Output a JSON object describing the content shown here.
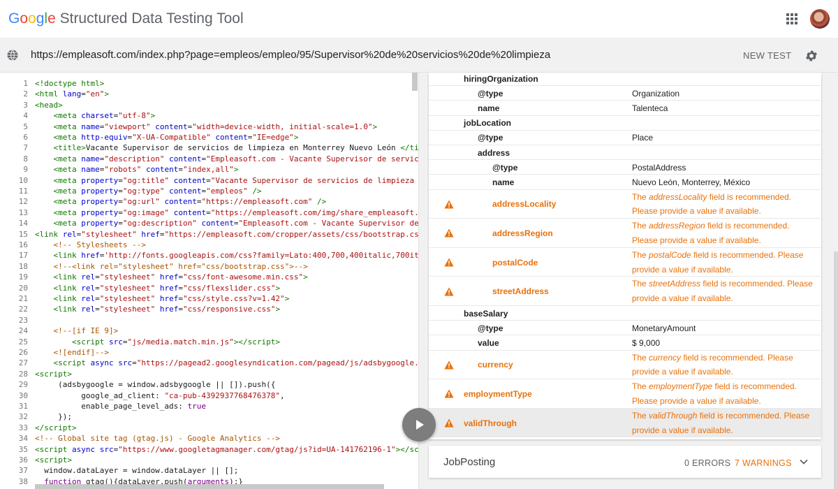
{
  "app": {
    "title_parts": [
      "G",
      "o",
      "o",
      "g",
      "l",
      "e"
    ],
    "title_rest": " Structured Data Testing Tool"
  },
  "toolbar": {
    "url": "https://empleasoft.com/index.php?page=empleos/empleo/95/Supervisor%20de%20servicios%20de%20limpieza",
    "new_test_label": "NEW TEST"
  },
  "colors": {
    "warning": "#e8710a",
    "accent_blue": "#4285f4"
  },
  "code": {
    "lines": [
      {
        "n": "1",
        "html": "<span class='tag'>&lt;!doctype html&gt;</span>"
      },
      {
        "n": "2",
        "html": "<span class='tag'>&lt;html</span> <span class='attr'>lang</span>=<span class='str'>\"en\"</span><span class='tag'>&gt;</span>"
      },
      {
        "n": "3",
        "html": "<span class='tag'>&lt;head&gt;</span>"
      },
      {
        "n": "4",
        "html": "    <span class='tag'>&lt;meta</span> <span class='attr'>charset</span>=<span class='str'>\"utf-8\"</span><span class='tag'>&gt;</span>"
      },
      {
        "n": "5",
        "html": "    <span class='tag'>&lt;meta</span> <span class='attr'>name</span>=<span class='str'>\"viewport\"</span> <span class='attr'>content</span>=<span class='str'>\"width=device-width, initial-scale=1.0\"</span><span class='tag'>&gt;</span>"
      },
      {
        "n": "6",
        "html": "    <span class='tag'>&lt;meta</span> <span class='attr'>http-equiv</span>=<span class='str'>\"X-UA-Compatible\"</span> <span class='attr'>content</span>=<span class='str'>\"IE=edge\"</span><span class='tag'>&gt;</span>"
      },
      {
        "n": "7",
        "html": "    <span class='tag'>&lt;title&gt;</span>Vacante Supervisor de servicios de limpieza en Monterrey Nuevo León <span class='tag'>&lt;/ti</span>"
      },
      {
        "n": "8",
        "html": "    <span class='tag'>&lt;meta</span> <span class='attr'>name</span>=<span class='str'>\"description\"</span> <span class='attr'>content</span>=<span class='str'>\"Empleasoft.com - Vacante Supervisor de servic</span>"
      },
      {
        "n": "9",
        "html": "    <span class='tag'>&lt;meta</span> <span class='attr'>name</span>=<span class='str'>\"robots\"</span> <span class='attr'>content</span>=<span class='str'>\"index,all\"</span><span class='tag'>&gt;</span>"
      },
      {
        "n": "10",
        "html": "    <span class='tag'>&lt;meta</span> <span class='attr'>property</span>=<span class='str'>\"og:title\"</span> <span class='attr'>content</span>=<span class='str'>\"Vacante Supervisor de servicios de limpieza</span>"
      },
      {
        "n": "11",
        "html": "    <span class='tag'>&lt;meta</span> <span class='attr'>property</span>=<span class='str'>\"og:type\"</span> <span class='attr'>content</span>=<span class='str'>\"empleos\"</span> <span class='tag'>/&gt;</span>"
      },
      {
        "n": "12",
        "html": "    <span class='tag'>&lt;meta</span> <span class='attr'>property</span>=<span class='str'>\"og:url\"</span> <span class='attr'>content</span>=<span class='str'>\"https://empleasoft.com\"</span> <span class='tag'>/&gt;</span>"
      },
      {
        "n": "13",
        "html": "    <span class='tag'>&lt;meta</span> <span class='attr'>property</span>=<span class='str'>\"og:image\"</span> <span class='attr'>content</span>=<span class='str'>\"https://empleasoft.com/img/share_empleasoft.</span>"
      },
      {
        "n": "14",
        "html": "    <span class='tag'>&lt;meta</span> <span class='attr'>property</span>=<span class='str'>\"og:description\"</span> <span class='attr'>content</span>=<span class='str'>\"Empleasoft.com - Vacante Supervisor de</span>"
      },
      {
        "n": "15",
        "html": "<span class='tag'>&lt;link</span> <span class='attr'>rel</span>=<span class='str'>\"stylesheet\"</span> <span class='attr'>href</span>=<span class='str'>\"https://empleasoft.com/cropper/assets/css/bootstrap.cs</span>"
      },
      {
        "n": "16",
        "html": "    <span class='cmt'>&lt;!-- Stylesheets --&gt;</span>"
      },
      {
        "n": "17",
        "html": "    <span class='tag'>&lt;link</span> <span class='attr'>href</span>=<span class='str'>'http://fonts.googleapis.com/css?family=Lato:400,700,400italic,700it</span>"
      },
      {
        "n": "18",
        "html": "    <span class='cmt'>&lt;!--&lt;link rel=\"stylesheet\" href=\"css/bootstrap.css\"&gt;--&gt;</span>"
      },
      {
        "n": "19",
        "html": "    <span class='tag'>&lt;link</span> <span class='attr'>rel</span>=<span class='str'>\"stylesheet\"</span> <span class='attr'>href</span>=<span class='str'>\"css/font-awesome.min.css\"</span><span class='tag'>&gt;</span>"
      },
      {
        "n": "20",
        "html": "    <span class='tag'>&lt;link</span> <span class='attr'>rel</span>=<span class='str'>\"stylesheet\"</span> <span class='attr'>href</span>=<span class='str'>\"css/flexslider.css\"</span><span class='tag'>&gt;</span>"
      },
      {
        "n": "21",
        "html": "    <span class='tag'>&lt;link</span> <span class='attr'>rel</span>=<span class='str'>\"stylesheet\"</span> <span class='attr'>href</span>=<span class='str'>\"css/style.css?v=1.42\"</span><span class='tag'>&gt;</span>"
      },
      {
        "n": "22",
        "html": "    <span class='tag'>&lt;link</span> <span class='attr'>rel</span>=<span class='str'>\"stylesheet\"</span> <span class='attr'>href</span>=<span class='str'>\"css/responsive.css\"</span><span class='tag'>&gt;</span>"
      },
      {
        "n": "23",
        "html": ""
      },
      {
        "n": "24",
        "html": "    <span class='cmt'>&lt;!--[if IE 9]&gt;</span>"
      },
      {
        "n": "25",
        "html": "        <span class='tag'>&lt;script</span> <span class='attr'>src</span>=<span class='str'>\"js/media.match.min.js\"</span><span class='tag'>&gt;&lt;/script&gt;</span>"
      },
      {
        "n": "26",
        "html": "    <span class='cmt'>&lt;![endif]--&gt;</span>"
      },
      {
        "n": "27",
        "html": "    <span class='tag'>&lt;script</span> <span class='attr'>async</span> <span class='attr'>src</span>=<span class='str'>\"https://pagead2.googlesyndication.com/pagead/js/adsbygoogle.</span>"
      },
      {
        "n": "28",
        "html": "<span class='tag'>&lt;script&gt;</span>"
      },
      {
        "n": "29",
        "html": "     (adsbygoogle = window.adsbygoogle || []).push({"
      },
      {
        "n": "30",
        "html": "          google_ad_client: <span class='str'>\"ca-pub-4392937768476378\"</span>,"
      },
      {
        "n": "31",
        "html": "          enable_page_level_ads: <span class='kw'>true</span>"
      },
      {
        "n": "32",
        "html": "     });"
      },
      {
        "n": "33",
        "html": "<span class='tag'>&lt;/script&gt;</span>"
      },
      {
        "n": "34",
        "html": "<span class='cmt'>&lt;!-- Global site tag (gtag.js) - Google Analytics --&gt;</span>"
      },
      {
        "n": "35",
        "html": "<span class='tag'>&lt;script</span> <span class='attr'>async</span> <span class='attr'>src</span>=<span class='str'>\"https://www.googletagmanager.com/gtag/js?id=UA-141762196-1\"</span><span class='tag'>&gt;&lt;/sc</span>"
      },
      {
        "n": "36",
        "html": "<span class='tag'>&lt;script&gt;</span>"
      },
      {
        "n": "37",
        "html": "  window.dataLayer = window.dataLayer || [];"
      },
      {
        "n": "38",
        "html": "  <span class='kw'>function</span> gtag(){dataLayer.push(<span class='kw'>arguments</span>);}"
      }
    ]
  },
  "results": {
    "rows": [
      {
        "key": "hiringOrganization",
        "level": 0,
        "value": "",
        "warn": false
      },
      {
        "key": "@type",
        "level": 1,
        "value": "Organization",
        "warn": false
      },
      {
        "key": "name",
        "level": 1,
        "value": "Talenteca",
        "warn": false
      },
      {
        "key": "jobLocation",
        "level": 0,
        "value": "",
        "warn": false
      },
      {
        "key": "@type",
        "level": 1,
        "value": "Place",
        "warn": false
      },
      {
        "key": "address",
        "level": 1,
        "value": "",
        "warn": false
      },
      {
        "key": "@type",
        "level": 2,
        "value": "PostalAddress",
        "warn": false
      },
      {
        "key": "name",
        "level": 2,
        "value": "Nuevo León, Monterrey, México",
        "warn": false
      },
      {
        "key": "addressLocality",
        "level": 2,
        "warn": true,
        "w_pre": "The ",
        "w_field": "addressLocality",
        "w_post": " field is recommended. Please provide a value if available."
      },
      {
        "key": "addressRegion",
        "level": 2,
        "warn": true,
        "w_pre": "The ",
        "w_field": "addressRegion",
        "w_post": " field is recommended. Please provide a value if available."
      },
      {
        "key": "postalCode",
        "level": 2,
        "warn": true,
        "w_pre": "The ",
        "w_field": "postalCode",
        "w_post": " field is recommended. Please provide a value if available."
      },
      {
        "key": "streetAddress",
        "level": 2,
        "warn": true,
        "w_pre": "The ",
        "w_field": "streetAddress",
        "w_post": " field is recommended. Please provide a value if available."
      },
      {
        "key": "baseSalary",
        "level": 0,
        "value": "",
        "warn": false
      },
      {
        "key": "@type",
        "level": 1,
        "value": "MonetaryAmount",
        "warn": false
      },
      {
        "key": "value",
        "level": 1,
        "value": "$ 9,000",
        "warn": false
      },
      {
        "key": "currency",
        "level": 1,
        "warn": true,
        "w_pre": "The ",
        "w_field": "currency",
        "w_post": " field is recommended. Please provide a value if available."
      },
      {
        "key": "employmentType",
        "level": 0,
        "warn": true,
        "w_pre": "The ",
        "w_field": "employmentType",
        "w_post": " field is recommended. Please provide a value if available."
      },
      {
        "key": "validThrough",
        "level": 0,
        "warn": true,
        "highlight": true,
        "w_pre": "The ",
        "w_field": "validThrough",
        "w_post": " field is recommended. Please provide a value if available."
      }
    ],
    "summary": {
      "title": "JobPosting",
      "errors": "0 ERRORS",
      "warnings": "7 WARNINGS"
    }
  },
  "icons": {
    "globe": "globe-icon",
    "gear": "gear-icon",
    "apps": "apps-grid-icon",
    "warning": "warning-icon",
    "chevron": "chevron-down-icon",
    "play": "play-icon"
  }
}
